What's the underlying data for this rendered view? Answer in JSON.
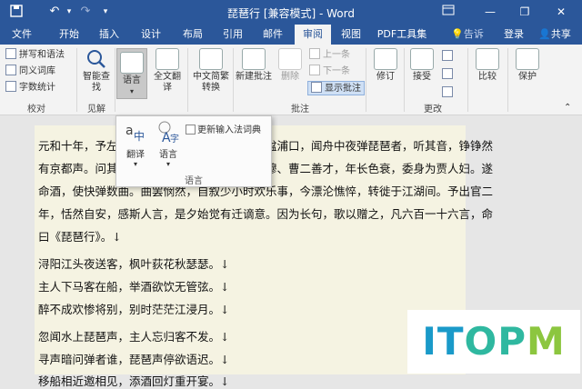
{
  "titlebar": {
    "title": "琵琶行 [兼容模式] - Word",
    "save_icon": "save-icon",
    "undo_icon": "undo-icon",
    "redo_icon": "redo-icon",
    "customize_icon": "customize-icon"
  },
  "tabs": [
    "文件",
    "开始",
    "插入",
    "设计",
    "布局",
    "引用",
    "邮件",
    "审阅",
    "视图",
    "PDF工具集"
  ],
  "tell_me": "告诉我...",
  "signin": "登录",
  "share": "共享",
  "ribbon": {
    "proofing": {
      "spell": "拼写和语法",
      "thesaurus": "同义词库",
      "wordcount": "字数统计",
      "label": "校对"
    },
    "insights": {
      "smart_lookup": "智能查找",
      "label": "见解"
    },
    "language": {
      "language_btn": "语言",
      "fulltext_translate": "全文翻译",
      "label": "语言"
    },
    "chinese_convert": {
      "label": "中文简繁转换"
    },
    "comments": {
      "new": "新建批注",
      "delete": "删除",
      "prev": "上一条",
      "next": "下一条",
      "show": "显示批注",
      "label": "批注"
    },
    "tracking": {
      "label": "修订"
    },
    "changes": {
      "accept": "接受",
      "label": "更改"
    },
    "compare": {
      "label": "比较"
    },
    "protect": {
      "label": "保护"
    }
  },
  "lang_popup": {
    "translate": "翻译",
    "language": "语言",
    "update_ime": "更新输入法词典",
    "group_label": "语言"
  },
  "document": {
    "lines": [
      "元和十年，予左迁九江郡司马。明年秋，送客湓浦口，闻舟中夜弹琵琶者，听其音，铮铮然",
      "有京都声。问其人，本长安倡女，尝学琵琶于穆、曹二善才，年长色衰，委身为贾人妇。遂",
      "命酒，使快弹数曲。曲罢悯然，自叙少小时欢乐事，今漂沦憔悴，转徙于江湖间。予出官二",
      "年，恬然自安，感斯人言，是夕始觉有迁谪意。因为长句，歌以赠之，凡六百一十六言，命",
      "曰《琵琶行》。↓",
      "浔阳江头夜送客，枫叶荻花秋瑟瑟。↓",
      "主人下马客在船，举酒欲饮无管弦。↓",
      "醉不成欢惨将别，别时茫茫江浸月。↓",
      "忽闻水上琵琶声，主人忘归客不发。↓",
      "寻声暗问弹者谁，琵琶声停欲语迟。↓",
      "移船相近邀相见，添酒回灯重开宴。↓"
    ]
  },
  "logo": {
    "text": "ITOPM",
    "colors": [
      "#1a9ac9",
      "#2fb8a0",
      "#8cc63f"
    ]
  }
}
